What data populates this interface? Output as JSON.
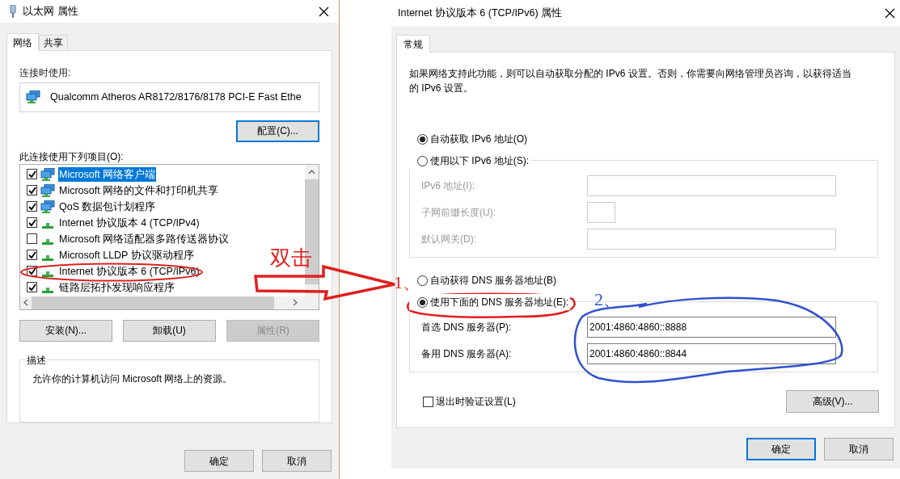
{
  "left_window": {
    "title": "以太网 属性",
    "tabs": [
      {
        "label": "网络",
        "selected": true
      },
      {
        "label": "共享",
        "selected": false
      }
    ],
    "connect_using_label": "连接时使用:",
    "adapter": "Qualcomm Atheros AR8172/8176/8178 PCI-E Fast Ethe",
    "configure_button": "配置(C)...",
    "items_label": "此连接使用下列项目(O):",
    "items": [
      {
        "label": "Microsoft 网络客户端",
        "checked": true,
        "selected": true,
        "kind": "service"
      },
      {
        "label": "Microsoft 网络的文件和打印机共享",
        "checked": true,
        "selected": false,
        "kind": "service"
      },
      {
        "label": "QoS 数据包计划程序",
        "checked": true,
        "selected": false,
        "kind": "service"
      },
      {
        "label": "Internet 协议版本 4 (TCP/IPv4)",
        "checked": true,
        "selected": false,
        "kind": "protocol"
      },
      {
        "label": "Microsoft 网络适配器多路传送器协议",
        "checked": false,
        "selected": false,
        "kind": "protocol"
      },
      {
        "label": "Microsoft LLDP 协议驱动程序",
        "checked": true,
        "selected": false,
        "kind": "protocol"
      },
      {
        "label": "Internet 协议版本 6 (TCP/IPv6)",
        "checked": true,
        "selected": false,
        "kind": "protocol"
      },
      {
        "label": "链路层拓扑发现响应程序",
        "checked": true,
        "selected": false,
        "kind": "protocol"
      }
    ],
    "buttons": [
      {
        "label": "安装(N)...",
        "disabled": false
      },
      {
        "label": "卸载(U)",
        "disabled": false
      },
      {
        "label": "属性(R)",
        "disabled": true
      }
    ],
    "description": {
      "title": "描述",
      "text": "允许你的计算机访问 Microsoft 网络上的资源。"
    },
    "footer_buttons": [
      {
        "label": "确定",
        "default": false
      },
      {
        "label": "取消",
        "default": false
      }
    ]
  },
  "right_window": {
    "title": "Internet 协议版本 6 (TCP/IPv6) 属性",
    "tabs": [
      {
        "label": "常规",
        "selected": true
      }
    ],
    "intro": "如果网络支持此功能，则可以自动获取分配的 IPv6 设置。否则，你需要向网络管理员咨询，以获得适当的 IPv6 设置。",
    "ip_options": [
      {
        "label": "自动获取 IPv6 地址(O)",
        "selected": true
      },
      {
        "label": "使用以下 IPv6 地址(S):",
        "selected": false
      }
    ],
    "ip_fields": [
      {
        "label": "IPv6 地址(I):",
        "kind": "wide",
        "disabled": true
      },
      {
        "label": "子网前缀长度(U):",
        "kind": "short",
        "disabled": true
      },
      {
        "label": "默认网关(D):",
        "kind": "wide",
        "disabled": true
      }
    ],
    "dns_options": [
      {
        "label": "自动获得 DNS 服务器地址(B)",
        "selected": false
      },
      {
        "label": "使用下面的 DNS 服务器地址(E):",
        "selected": true
      }
    ],
    "dns_fields": [
      {
        "label": "首选 DNS 服务器(P):",
        "value": "2001:4860:4860::8888",
        "kind": "wide",
        "disabled": false
      },
      {
        "label": "备用 DNS 服务器(A):",
        "value": "2001:4860:4860::8844",
        "kind": "wide",
        "disabled": false
      }
    ],
    "validate_checkbox": {
      "label": "退出时验证设置(L)",
      "checked": false
    },
    "advanced_button": "高级(V)...",
    "footer_buttons": [
      {
        "label": "确定",
        "default": true
      },
      {
        "label": "取消",
        "default": false
      }
    ]
  },
  "annotations": {
    "double_click": "双击",
    "step_1": "1、",
    "step_2": "2、"
  }
}
